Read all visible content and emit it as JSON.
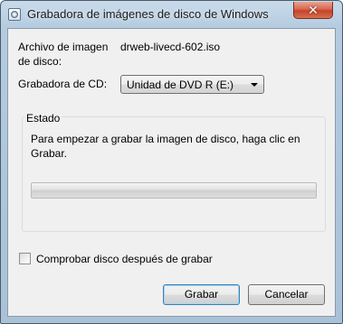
{
  "window": {
    "title": "Grabadora de imágenes de disco de Windows",
    "close_glyph": "✕"
  },
  "form": {
    "image_label_line1": "Archivo de imagen",
    "image_label_line2": "de disco:",
    "image_file": "drweb-livecd-602.iso",
    "burner_label": "Grabadora de CD:",
    "burner_selected": "Unidad de DVD R (E:)"
  },
  "status": {
    "group_title": "Estado",
    "message_line1": "Para empezar a grabar la imagen de disco, haga clic en",
    "message_line2": "Grabar.",
    "progress_percent": 0
  },
  "verify": {
    "label": "Comprobar disco después de grabar",
    "checked": false
  },
  "buttons": {
    "burn": "Grabar",
    "cancel": "Cancelar"
  },
  "colors": {
    "close_button": "#c5422a",
    "default_button_border": "#3c7fb1"
  },
  "icons": {
    "title": "disc-burner-icon",
    "close": "close-icon",
    "dropdown": "chevron-down-icon"
  }
}
